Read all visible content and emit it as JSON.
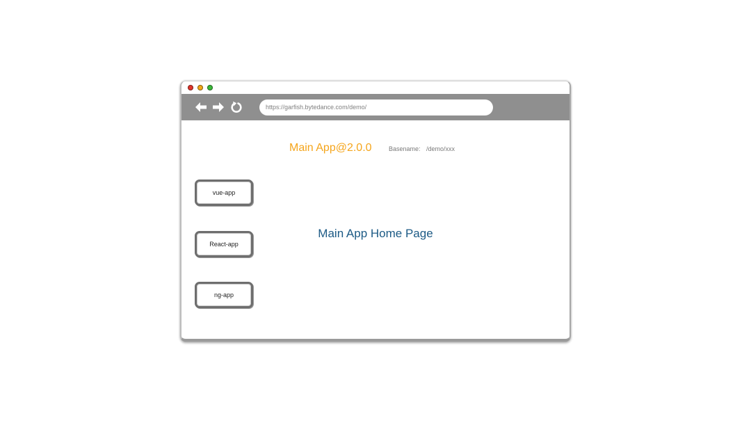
{
  "window": {
    "traffic_lights": [
      {
        "name": "close",
        "color": "#e0352b"
      },
      {
        "name": "minimize",
        "color": "#f2a818"
      },
      {
        "name": "maximize",
        "color": "#3cb93b"
      }
    ]
  },
  "toolbar": {
    "back_icon": "arrow-left-icon",
    "forward_icon": "arrow-right-icon",
    "reload_icon": "reload-icon",
    "url": "https://garfish.bytedance.com/demo/"
  },
  "header": {
    "app_title": "Main App@2.0.0",
    "basename_label": "Basename:",
    "basename_value": "/demo/xxx"
  },
  "sidebar": {
    "buttons": [
      {
        "label": "vue-app"
      },
      {
        "label": "React-app"
      },
      {
        "label": "ng-app"
      }
    ]
  },
  "main": {
    "title": "Main App Home Page"
  },
  "colors": {
    "toolbar_bg": "#8f8f8f",
    "app_title": "#f5a51b",
    "home_title": "#1c5a85"
  }
}
